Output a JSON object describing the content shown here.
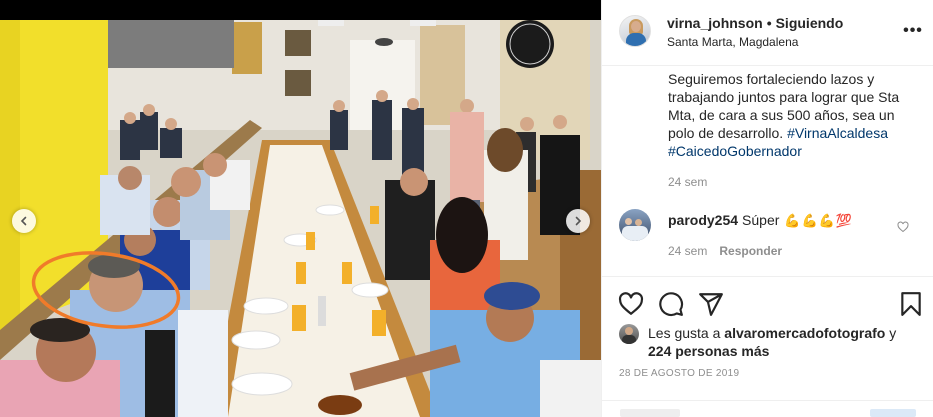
{
  "post": {
    "username": "virna_johnson",
    "separator": "•",
    "follow_status": "Siguiendo",
    "location": "Santa Marta, Magdalena",
    "more_glyph": "•••"
  },
  "caption": {
    "text": "Seguiremos fortaleciendo lazos y trabajando juntos para lograr que Sta Mta, de cara a sus 500 años, sea un polo de desarrollo.",
    "hashtag_1": "#VirnaAlcaldesa",
    "hashtag_2": "#CaicedoGobernador",
    "time": "24 sem"
  },
  "comment": {
    "username": "parody254",
    "text": "Súper",
    "emojis": [
      "💪",
      "💪",
      "💪",
      "💯"
    ],
    "time": "24 sem",
    "reply_label": "Responder"
  },
  "likes": {
    "prefix": "Les gusta a",
    "user": "alvaromercadofotografo",
    "conjunction": "y",
    "others": "224 personas más"
  },
  "date": "28 DE AGOSTO DE 2019",
  "colors": {
    "hashtag": "#00376b",
    "muted": "#8e8e8e",
    "annotation_circle": "#f07b2a",
    "wall_yellow": "#f4e12a"
  },
  "icons": {
    "like": "heart-outline-icon",
    "comment": "speech-bubble-icon",
    "share": "paper-plane-icon",
    "save": "bookmark-icon",
    "prev": "chevron-left-icon",
    "next": "chevron-right-icon",
    "comment_like": "small-heart-icon"
  }
}
